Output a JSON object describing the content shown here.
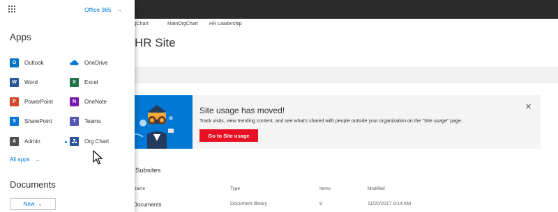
{
  "launcher": {
    "office365_link": "Office 365",
    "apps_heading": "Apps",
    "apps": [
      {
        "label": "Outlook",
        "glyph": "O",
        "color": "#0072c6"
      },
      {
        "label": "Word",
        "glyph": "W",
        "color": "#2b579a"
      },
      {
        "label": "PowerPoint",
        "glyph": "P",
        "color": "#d24726"
      },
      {
        "label": "SharePoint",
        "glyph": "S",
        "color": "#0078d4"
      },
      {
        "label": "Admin",
        "glyph": "A",
        "color": "#505050"
      },
      {
        "label": "OneDrive",
        "glyph": "",
        "color": "#0078d4"
      },
      {
        "label": "Excel",
        "glyph": "X",
        "color": "#217346"
      },
      {
        "label": "OneNote",
        "glyph": "N",
        "color": "#7719aa"
      },
      {
        "label": "Teams",
        "glyph": "T",
        "color": "#5558af"
      },
      {
        "label": "Org Chart",
        "glyph": "",
        "color": "#2b579a"
      }
    ],
    "all_apps": "All apps",
    "documents_heading": "Documents",
    "new_button": "New"
  },
  "breadcrumbs": [
    "OrgChart",
    "MainOrgChart",
    "HR Leadership"
  ],
  "site_title": "HR Site",
  "banner": {
    "title": "Site usage has moved!",
    "description": "Track visits, view trending content, and see what's shared with people outside your organization on the \"Site usage\" page.",
    "button": "Go to Site usage"
  },
  "subsites_heading": "Subsites",
  "table": {
    "columns": [
      "Name",
      "Type",
      "Items",
      "Modified"
    ],
    "rows": [
      {
        "name": "Documents",
        "type": "Document library",
        "items": "9",
        "modified": "11/20/2017 9:14 AM"
      }
    ]
  }
}
